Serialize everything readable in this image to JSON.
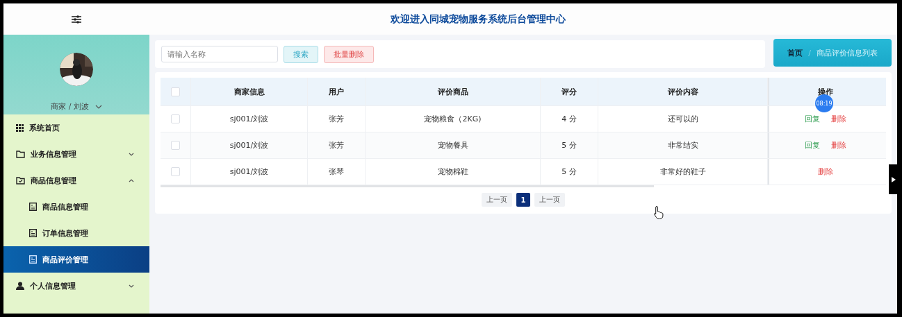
{
  "header": {
    "title": "欢迎进入同城宠物服务系统后台管理中心"
  },
  "sidebar": {
    "user": "商家 / 刘波",
    "menu": [
      {
        "label": "系统首页",
        "selected": false
      },
      {
        "label": "业务信息管理",
        "expanded": false,
        "selected": false
      },
      {
        "label": "商品信息管理",
        "expanded": true,
        "selected": false,
        "children": [
          {
            "label": "商品信息管理",
            "selected": false
          },
          {
            "label": "订单信息管理",
            "selected": false
          },
          {
            "label": "商品评价管理",
            "selected": true
          }
        ]
      },
      {
        "label": "个人信息管理",
        "expanded": false,
        "selected": false
      }
    ]
  },
  "toolbar": {
    "search": {
      "placeholder": "请输入名称"
    },
    "buttons": [
      {
        "label": "搜索",
        "kind": "search"
      },
      {
        "label": "批量删除",
        "kind": "delete"
      }
    ]
  },
  "breadcrumb": {
    "separator": "/",
    "items": [
      "首页",
      "商品评价信息列表"
    ]
  },
  "table": {
    "all_checked": false,
    "columns": [
      "商家信息",
      "用户",
      "评价商品",
      "评分",
      "评价内容",
      "操作"
    ],
    "rows": [
      {
        "checked": false,
        "cells": [
          "sj001/刘波",
          "张芳",
          "宠物粮食（2KG)",
          "4 分",
          "还可以的"
        ],
        "actions": [
          {
            "label": "回复",
            "kind": "reply"
          },
          {
            "label": "删除",
            "kind": "delete"
          }
        ]
      },
      {
        "checked": false,
        "cells": [
          "sj001/刘波",
          "张芳",
          "宠物餐具",
          "5 分",
          "非常结实"
        ],
        "actions": [
          {
            "label": "回复",
            "kind": "reply"
          },
          {
            "label": "删除",
            "kind": "delete"
          }
        ]
      },
      {
        "checked": false,
        "cells": [
          "sj001/刘波",
          "张琴",
          "宠物棉鞋",
          "5 分",
          "非常好的鞋子"
        ],
        "actions": [
          {
            "label": "删除",
            "kind": "delete"
          }
        ]
      }
    ]
  },
  "pagination": [
    {
      "label": "上一页",
      "selected": false
    },
    {
      "label": "1",
      "selected": true
    },
    {
      "label": "上一页",
      "selected": false
    }
  ],
  "overlay": {
    "time": "08:19"
  }
}
